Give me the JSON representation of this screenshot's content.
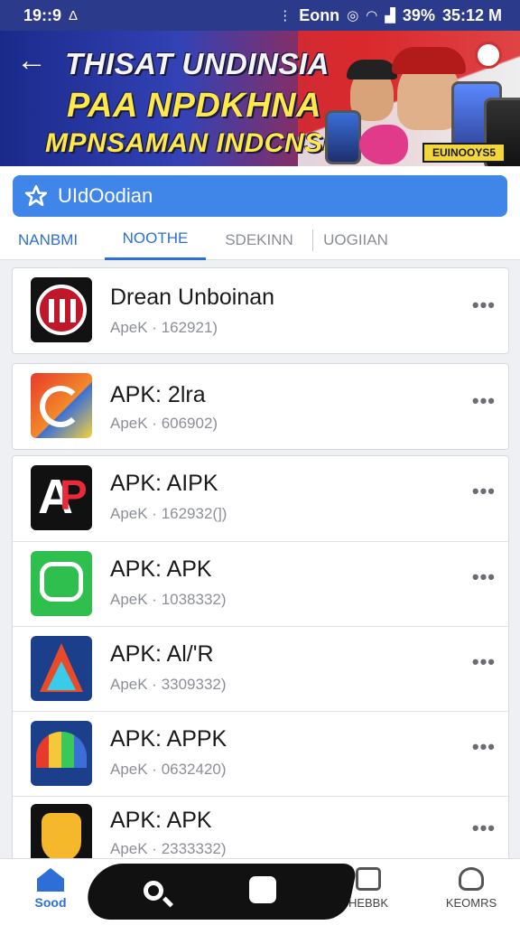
{
  "status_bar": {
    "time": "19::9",
    "left_glyph": "Δ",
    "carrier": "Eonn",
    "battery": "39%",
    "clock_right": "35:12 M"
  },
  "banner": {
    "line1": "THISAT UNDINSIA",
    "line2": "PAA NPDKHNA",
    "line3": "MPNSAMAN INDCNSIA",
    "badge": "EUINOOYS5"
  },
  "search": {
    "placeholder": "UIdOodian"
  },
  "tabs": [
    {
      "label": "NANBMI"
    },
    {
      "label": "NOOTHE"
    },
    {
      "label": "SDEKINN"
    },
    {
      "label": "UOGIIAN"
    }
  ],
  "apps": [
    {
      "name": "Drean Unboinan",
      "meta": "ApeK · 162921)",
      "icon": "record-bars-icon"
    },
    {
      "name": "APK: 2lra",
      "meta": "ApeK · 606902)",
      "icon": "swirl-app-icon"
    },
    {
      "name": "APK: AIPK",
      "meta": "ApeK · 162932(])",
      "icon": "ap-logo-icon"
    },
    {
      "name": "APK: APK",
      "meta": "ApeK · 1038332)",
      "icon": "chat-bubble-icon"
    },
    {
      "name": "APK: Al/'R",
      "meta": "ApeK · 3309332)",
      "icon": "triangle-a-icon"
    },
    {
      "name": "APK: APPK",
      "meta": "ApeK · 0632420)",
      "icon": "rainbow-arch-icon"
    },
    {
      "name": "APK: APK",
      "meta": "ApeK · 2333332)",
      "icon": "gold-crown-icon"
    }
  ],
  "bottom_nav": {
    "home_label": "Sood",
    "news_label": "HEBBK",
    "profile_label": "KEOMRS"
  },
  "colors": {
    "accent": "#2d6fd6",
    "search_bg": "#3f86e8",
    "status_bar": "#2c3a8c"
  }
}
